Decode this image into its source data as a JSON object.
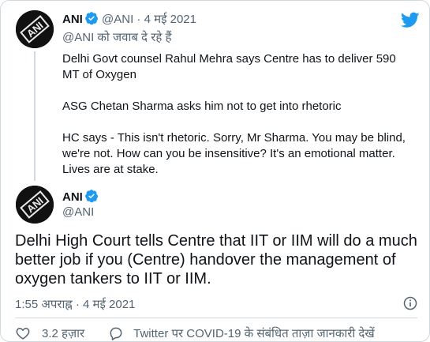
{
  "quoted_tweet": {
    "author_name": "ANI",
    "handle": "@ANI",
    "separator": "·",
    "date": "4 मई 2021",
    "replying_to": "@ANI को जवाब दे रहे हैं",
    "paragraphs": [
      "Delhi Govt counsel Rahul Mehra says Centre has to deliver 590 MT of Oxygen",
      "ASG Chetan Sharma asks him not to get into rhetoric",
      "HC says - This isn't rhetoric. Sorry, Mr Sharma. You may be blind, we're not. How can you be insensitive? It's an emotional matter. Lives are at stake."
    ]
  },
  "main_tweet": {
    "author_name": "ANI",
    "handle": "@ANI",
    "text": "Delhi High Court tells Centre that IIT or IIM will do a much better job if you (Centre) handover the management of oxygen tankers to IIT or IIM.",
    "timestamp": "1:55 अपराह्न · 4 मई 2021"
  },
  "avatar_label": "ANI",
  "footer": {
    "like_count": "3.2 हज़ार",
    "cta_text": "Twitter पर COVID-19 के संबंधित ताज़ा जानकारी देखें"
  },
  "colors": {
    "twitter_blue": "#1d9bf0",
    "muted": "#536471",
    "border": "#cfd9de"
  },
  "icons": [
    "twitter-logo-icon",
    "verified-badge-icon",
    "info-icon",
    "heart-icon",
    "comment-icon"
  ]
}
